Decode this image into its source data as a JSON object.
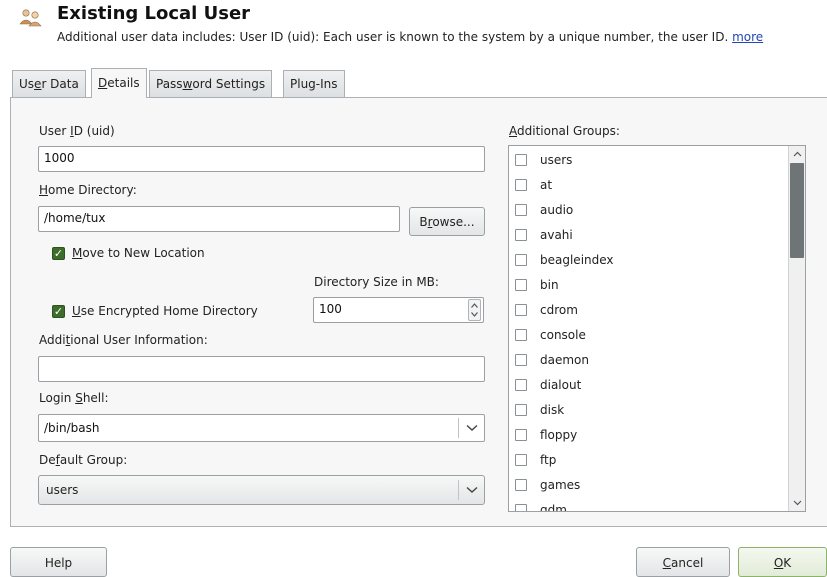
{
  "header": {
    "icon": "users-icon",
    "title": "Existing Local User",
    "subtitle": "Additional user data includes: User ID (uid): Each user is known to the system by a unique number, the user ID.",
    "more_link": "more"
  },
  "tabs": [
    {
      "pre": "Us",
      "key": "e",
      "post": "r Data"
    },
    {
      "pre": "",
      "key": "D",
      "post": "etails"
    },
    {
      "pre": "Pass",
      "key": "w",
      "post": "ord Settings"
    },
    {
      "pre": "Plug-Ins",
      "key": "",
      "post": ""
    }
  ],
  "active_tab": "Details",
  "details": {
    "uid_label": {
      "pre": "User ",
      "key": "I",
      "post": "D (uid)"
    },
    "uid_value": "1000",
    "home_label": {
      "pre": "",
      "key": "H",
      "post": "ome Directory:"
    },
    "home_value": "/home/tux",
    "browse": {
      "pre": "B",
      "key": "r",
      "post": "owse..."
    },
    "move_label": {
      "pre": "",
      "key": "M",
      "post": "ove to New Location"
    },
    "move_checked": true,
    "dirsize_label": "Directory Size in MB:",
    "dirsize_value": "100",
    "encrypt_label": {
      "pre": "",
      "key": "U",
      "post": "se Encrypted Home Directory"
    },
    "encrypt_checked": true,
    "addinfo_label": {
      "pre": "Addi",
      "key": "t",
      "post": "ional User Information:"
    },
    "addinfo_value": "",
    "shell_label": {
      "pre": "Login ",
      "key": "S",
      "post": "hell:"
    },
    "shell_value": "/bin/bash",
    "group_label": {
      "pre": "De",
      "key": "f",
      "post": "ault Group:"
    },
    "group_value": "users"
  },
  "additional_groups": {
    "label": {
      "pre": "",
      "key": "A",
      "post": "dditional Groups:"
    },
    "items": [
      "users",
      "at",
      "audio",
      "avahi",
      "beagleindex",
      "bin",
      "cdrom",
      "console",
      "daemon",
      "dialout",
      "disk",
      "floppy",
      "ftp",
      "games",
      "gdm"
    ]
  },
  "buttons": {
    "help": "Help",
    "cancel": {
      "pre": "",
      "key": "C",
      "post": "ancel"
    },
    "ok": {
      "pre": "",
      "key": "O",
      "post": "K"
    }
  },
  "colors": {
    "link": "#2346b8",
    "checkbox": "#3c6d2a"
  }
}
